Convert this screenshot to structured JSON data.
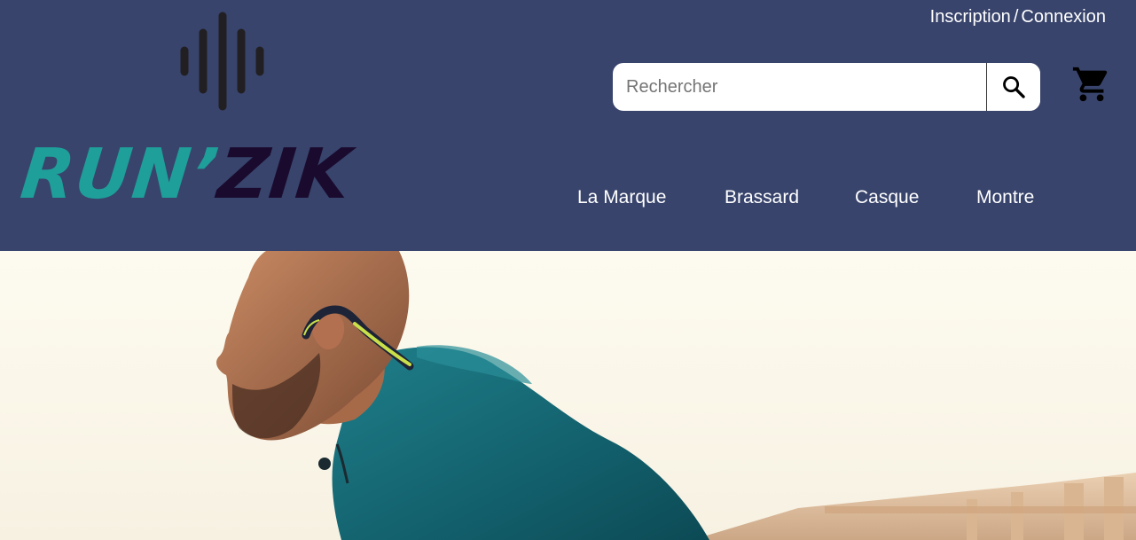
{
  "header": {
    "background_color": "#38446c",
    "logo": {
      "part1": "RUN’",
      "part2": "ZIK",
      "part1_color": "#1e9f9a",
      "part2_color": "#1a0b2e",
      "icon": "sound-wave-icon"
    },
    "auth": {
      "signup_label": "Inscription",
      "separator": "/",
      "login_label": "Connexion"
    },
    "search": {
      "placeholder": "Rechercher",
      "value": "",
      "icon": "search-icon"
    },
    "cart": {
      "icon": "shopping-cart-icon"
    },
    "nav": [
      {
        "label": "La Marque"
      },
      {
        "label": "Brassard"
      },
      {
        "label": "Casque"
      },
      {
        "label": "Montre"
      }
    ]
  },
  "hero": {
    "image": "runner-with-bone-conduction-headphones-photo"
  }
}
